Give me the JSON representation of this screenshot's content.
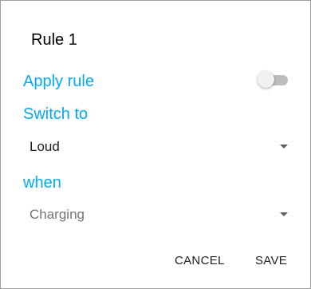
{
  "dialog": {
    "title": "Rule 1",
    "apply_rule": {
      "label": "Apply rule",
      "enabled": false
    },
    "switch_to": {
      "label": "Switch to",
      "selected": "Loud"
    },
    "when": {
      "label": "when",
      "selected": "Charging"
    },
    "actions": {
      "cancel": "CANCEL",
      "save": "SAVE"
    }
  },
  "colors": {
    "accent": "#03a9f4",
    "toggle_off_track": "#bdbdbd",
    "toggle_off_thumb": "#f1f1f1"
  },
  "icons": {
    "spinner_arrow": "dropdown-arrow-icon"
  }
}
